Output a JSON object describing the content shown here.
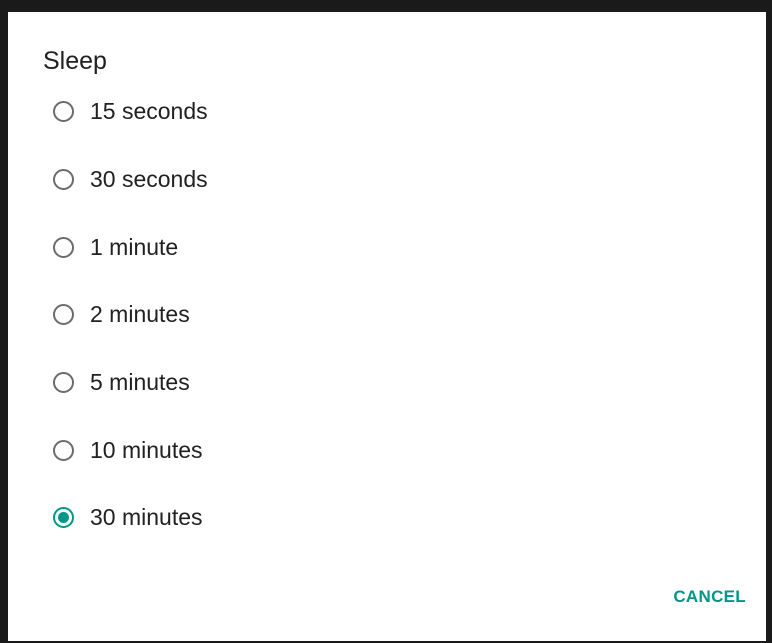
{
  "dialog": {
    "title": "Sleep",
    "options": [
      {
        "label": "15 seconds",
        "checked": false
      },
      {
        "label": "30 seconds",
        "checked": false
      },
      {
        "label": "1 minute",
        "checked": false
      },
      {
        "label": "2 minutes",
        "checked": false
      },
      {
        "label": "5 minutes",
        "checked": false
      },
      {
        "label": "10 minutes",
        "checked": false
      },
      {
        "label": "30 minutes",
        "checked": true
      }
    ],
    "cancel_label": "CANCEL"
  },
  "colors": {
    "accent": "#009688",
    "radio_unchecked": "#6b6b6b",
    "text": "#212121"
  }
}
